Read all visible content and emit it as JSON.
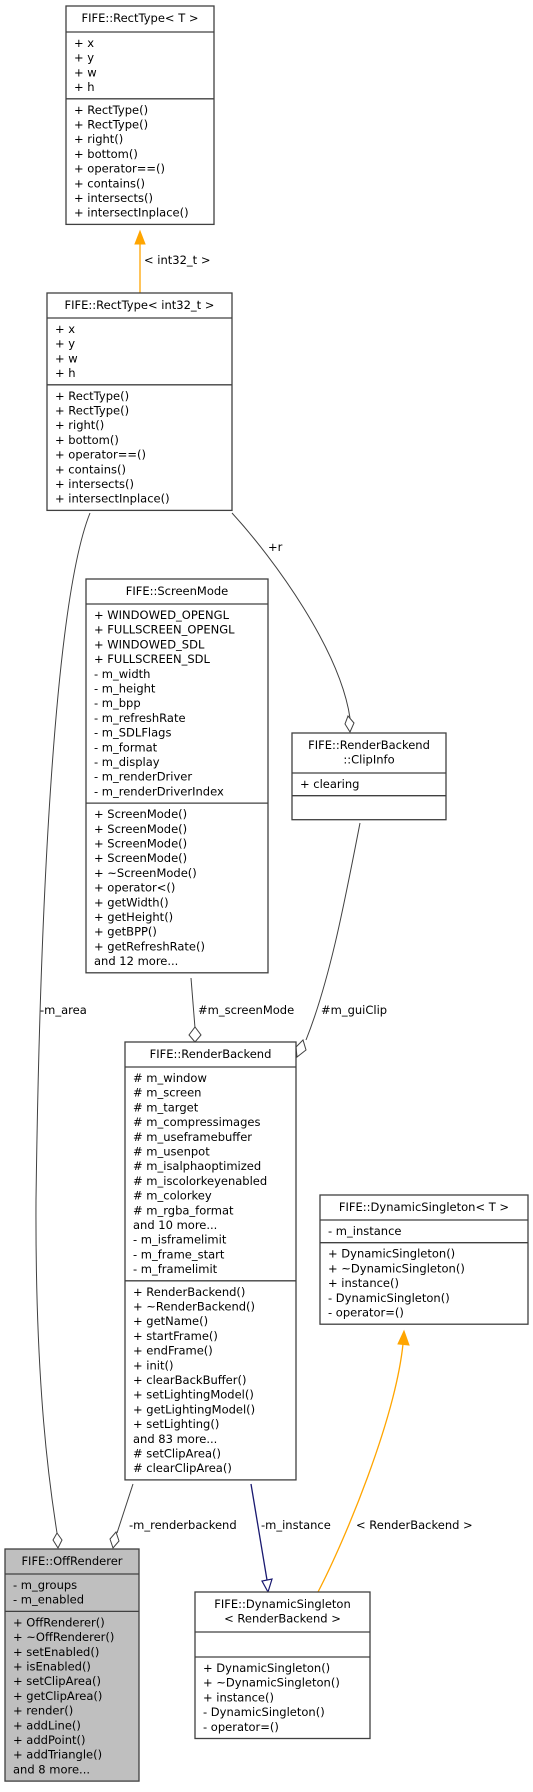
{
  "diagram": {
    "type": "uml-collaboration",
    "classes": {
      "rect_t": {
        "title": [
          "FIFE::RectType< T >"
        ],
        "attributes": [
          "+ x",
          "+ y",
          "+ w",
          "+ h"
        ],
        "methods": [
          "+ RectType()",
          "+ RectType()",
          "+ right()",
          "+ bottom()",
          "+ operator==()",
          "+ contains()",
          "+ intersects()",
          "+ intersectInplace()"
        ]
      },
      "rect_int32": {
        "title": [
          "FIFE::RectType< int32_t >"
        ],
        "attributes": [
          "+ x",
          "+ y",
          "+ w",
          "+ h"
        ],
        "methods": [
          "+ RectType()",
          "+ RectType()",
          "+ right()",
          "+ bottom()",
          "+ operator==()",
          "+ contains()",
          "+ intersects()",
          "+ intersectInplace()"
        ]
      },
      "screenmode": {
        "title": [
          "FIFE::ScreenMode"
        ],
        "attributes": [
          "+ WINDOWED_OPENGL",
          "+ FULLSCREEN_OPENGL",
          "+ WINDOWED_SDL",
          "+ FULLSCREEN_SDL",
          "- m_width",
          "- m_height",
          "- m_bpp",
          "- m_refreshRate",
          "- m_SDLFlags",
          "- m_format",
          "- m_display",
          "- m_renderDriver",
          "- m_renderDriverIndex"
        ],
        "methods": [
          "+ ScreenMode()",
          "+ ScreenMode()",
          "+ ScreenMode()",
          "+ ScreenMode()",
          "+ ~ScreenMode()",
          "+ operator<()",
          "+ getWidth()",
          "+ getHeight()",
          "+ getBPP()",
          "+ getRefreshRate()",
          "and 12 more..."
        ]
      },
      "clipinfo": {
        "title": [
          "FIFE::RenderBackend",
          "::ClipInfo"
        ],
        "attributes": [
          "+ clearing"
        ],
        "methods": []
      },
      "renderbackend": {
        "title": [
          "FIFE::RenderBackend"
        ],
        "attributes": [
          "# m_window",
          "# m_screen",
          "# m_target",
          "# m_compressimages",
          "# m_useframebuffer",
          "# m_usenpot",
          "# m_isalphaoptimized",
          "# m_iscolorkeyenabled",
          "# m_colorkey",
          "# m_rgba_format",
          "and 10 more...",
          "- m_isframelimit",
          "- m_frame_start",
          "- m_framelimit"
        ],
        "methods": [
          "+ RenderBackend()",
          "+ ~RenderBackend()",
          "+ getName()",
          "+ startFrame()",
          "+ endFrame()",
          "+ init()",
          "+ clearBackBuffer()",
          "+ setLightingModel()",
          "+ getLightingModel()",
          "+ setLighting()",
          "and 83 more...",
          "# setClipArea()",
          "# clearClipArea()"
        ]
      },
      "dynsingleton_t": {
        "title": [
          "FIFE::DynamicSingleton< T >"
        ],
        "attributes": [
          "- m_instance"
        ],
        "methods": [
          "+ DynamicSingleton()",
          "+ ~DynamicSingleton()",
          "+ instance()",
          "- DynamicSingleton()",
          "- operator=()"
        ]
      },
      "offrenderer": {
        "title": [
          "FIFE::OffRenderer"
        ],
        "attributes": [
          "- m_groups",
          "- m_enabled"
        ],
        "methods": [
          "+ OffRenderer()",
          "+ ~OffRenderer()",
          "+ setEnabled()",
          "+ isEnabled()",
          "+ setClipArea()",
          "+ getClipArea()",
          "+ render()",
          "+ addLine()",
          "+ addPoint()",
          "+ addTriangle()",
          "and 8 more..."
        ]
      },
      "dynsingleton_rb": {
        "title": [
          "FIFE::DynamicSingleton",
          "< RenderBackend >"
        ],
        "attributes": [],
        "methods": [
          "+ DynamicSingleton()",
          "+ ~DynamicSingleton()",
          "+ instance()",
          "- DynamicSingleton()",
          "- operator=()"
        ]
      }
    },
    "edge_labels": {
      "template_int32": "< int32_t >",
      "r": "+r",
      "m_area": "-m_area",
      "m_screenMode": "#m_screenMode",
      "m_guiClip": "#m_guiClip",
      "m_renderbackend": "-m_renderbackend",
      "m_instance": "-m_instance",
      "template_rb": "< RenderBackend >"
    },
    "colors": {
      "template_edge": "#ffa500",
      "inheritance_edge": "#191970",
      "usage_edge": "#404040",
      "focus_fill": "#bfbfbf"
    }
  }
}
